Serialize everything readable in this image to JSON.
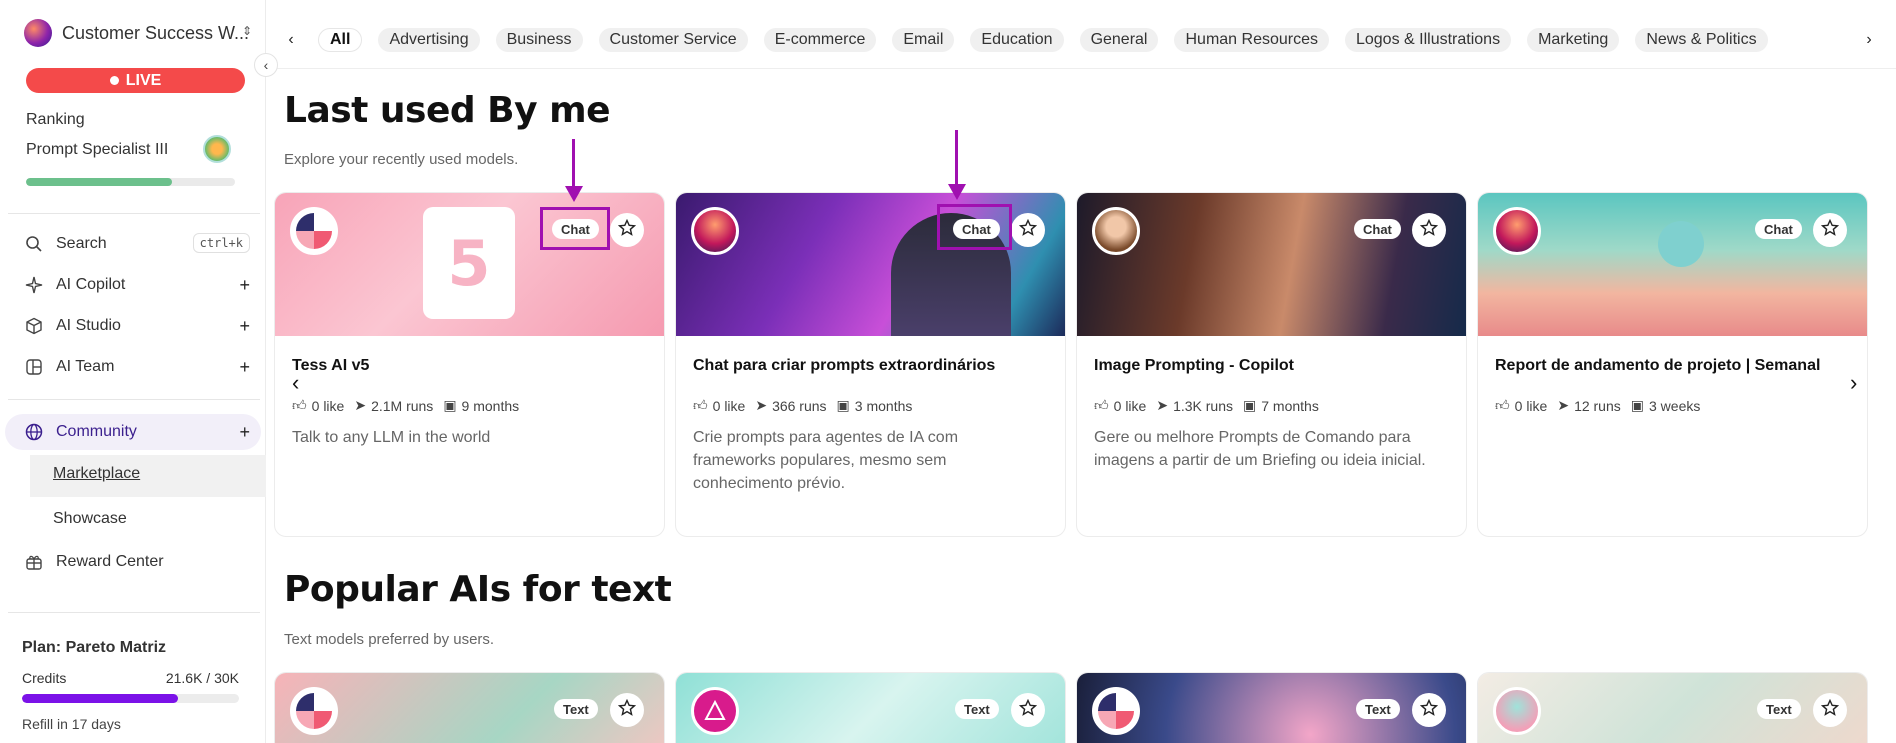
{
  "sidebar": {
    "workspace": "Customer Success W...",
    "live_label": "LIVE",
    "ranking_label": "Ranking",
    "ranking_title": "Prompt Specialist III",
    "ranking_progress": 0.7,
    "nav": {
      "search": "Search",
      "search_shortcut": "ctrl+k",
      "ai_copilot": "AI Copilot",
      "ai_studio": "AI Studio",
      "ai_team": "AI Team",
      "community": "Community",
      "marketplace": "Marketplace",
      "showcase": "Showcase",
      "reward_center": "Reward Center"
    },
    "plan": "Plan: Pareto Matriz",
    "credits_label": "Credits",
    "credits_value": "21.6K / 30K",
    "credits_progress": 0.72,
    "refill": "Refill in 17 days"
  },
  "categories": [
    "All",
    "Advertising",
    "Business",
    "Customer Service",
    "E-commerce",
    "Email",
    "Education",
    "General",
    "Human Resources",
    "Logos & Illustrations",
    "Marketing",
    "News & Politics"
  ],
  "sections": {
    "last_used": {
      "title": "Last used By me",
      "subtitle": "Explore your recently used models.",
      "cards": [
        {
          "title": "Tess AI v5",
          "tag": "Chat",
          "likes": "0 like",
          "runs": "2.1M runs",
          "age": "9 months",
          "desc": "Talk to any LLM in the world"
        },
        {
          "title": "Chat para criar prompts extraordinários",
          "tag": "Chat",
          "likes": "0 like",
          "runs": "366 runs",
          "age": "3 months",
          "desc": "Crie prompts para agentes de IA com frameworks populares, mesmo sem conhecimento prévio."
        },
        {
          "title": "Image Prompting - Copilot",
          "tag": "Chat",
          "likes": "0 like",
          "runs": "1.3K runs",
          "age": "7 months",
          "desc": "Gere ou melhore Prompts de Comando para imagens a partir de um Briefing ou ideia inicial."
        },
        {
          "title": "Report de andamento de projeto | Semanal",
          "tag": "Chat",
          "likes": "0 like",
          "runs": "12 runs",
          "age": "3 weeks",
          "desc": ""
        }
      ]
    },
    "popular_text": {
      "title": "Popular AIs for text",
      "subtitle": "Text models preferred by users.",
      "cards": [
        {
          "tag": "Text"
        },
        {
          "tag": "Text"
        },
        {
          "tag": "Text"
        },
        {
          "tag": "Text"
        }
      ]
    }
  },
  "colors": {
    "accent": "#7b12e8",
    "live": "#f44a4a",
    "annotation": "#a010b0",
    "ranking_bar": "#6cc08c"
  }
}
